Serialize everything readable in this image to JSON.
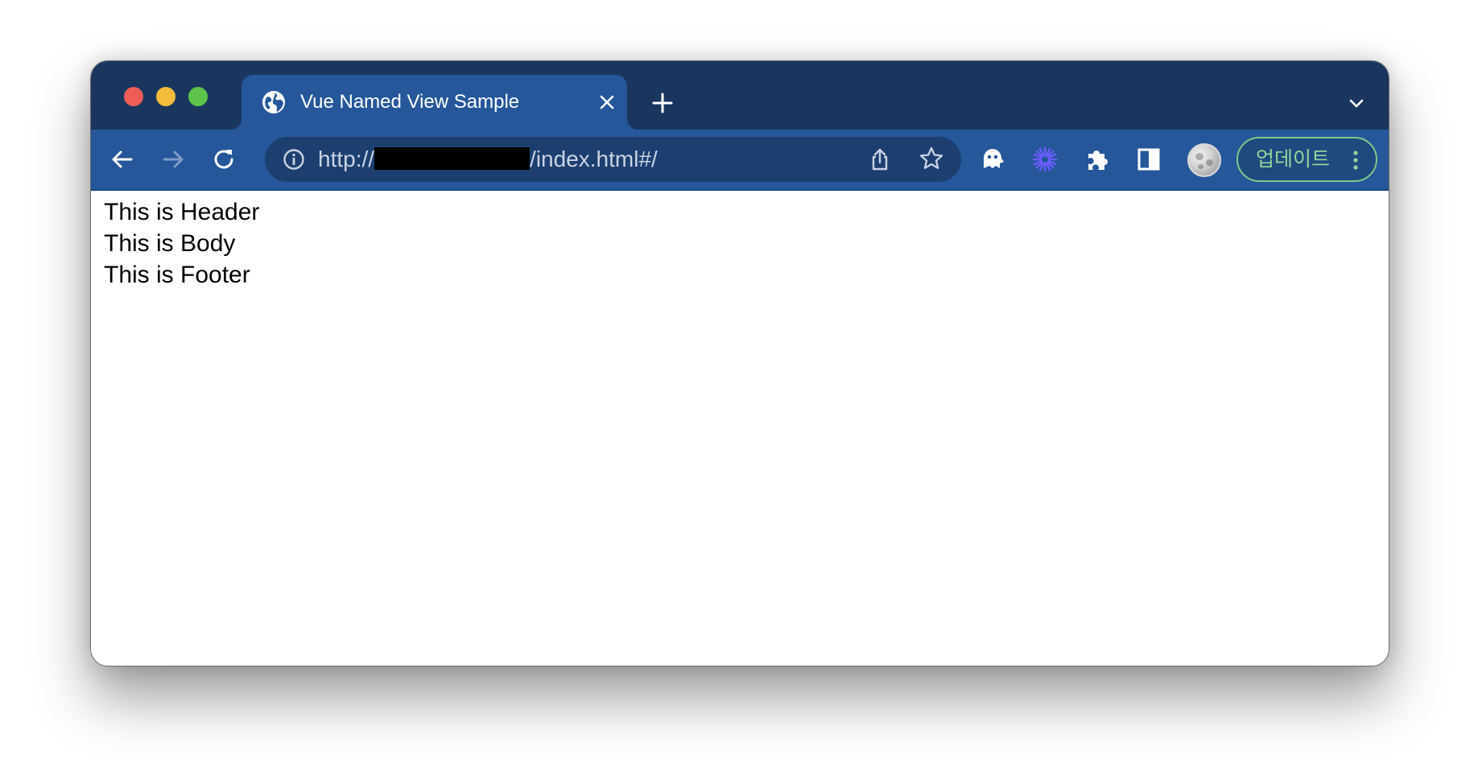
{
  "tab": {
    "title": "Vue Named View Sample"
  },
  "omnibox": {
    "url_prefix": "http://",
    "url_suffix": "/index.html#/"
  },
  "profile": {
    "update_label": "업데이트"
  },
  "page": {
    "lines": [
      "This is Header",
      "This is Body",
      "This is Footer"
    ]
  },
  "icons": {
    "favicon": "globe-icon",
    "close": "close-icon",
    "new_tab": "plus-icon",
    "tab_list": "chevron-down-icon",
    "back": "back-arrow-icon",
    "forward": "forward-arrow-icon",
    "reload": "reload-icon",
    "info": "info-icon",
    "share": "share-icon",
    "bookmark": "star-icon",
    "extension_1": "ghost-icon",
    "extension_2": "asterisk-icon",
    "extensions": "puzzle-icon",
    "side_panel": "side-panel-icon",
    "menu": "kebab-menu-icon"
  },
  "colors": {
    "titlebar": "#1a365f",
    "active_tab": "#25579a",
    "toolbar": "#25579a",
    "omnibox": "#1c3f70",
    "update_accent": "#8fd69a",
    "extension_accent": "#6a5cff"
  }
}
